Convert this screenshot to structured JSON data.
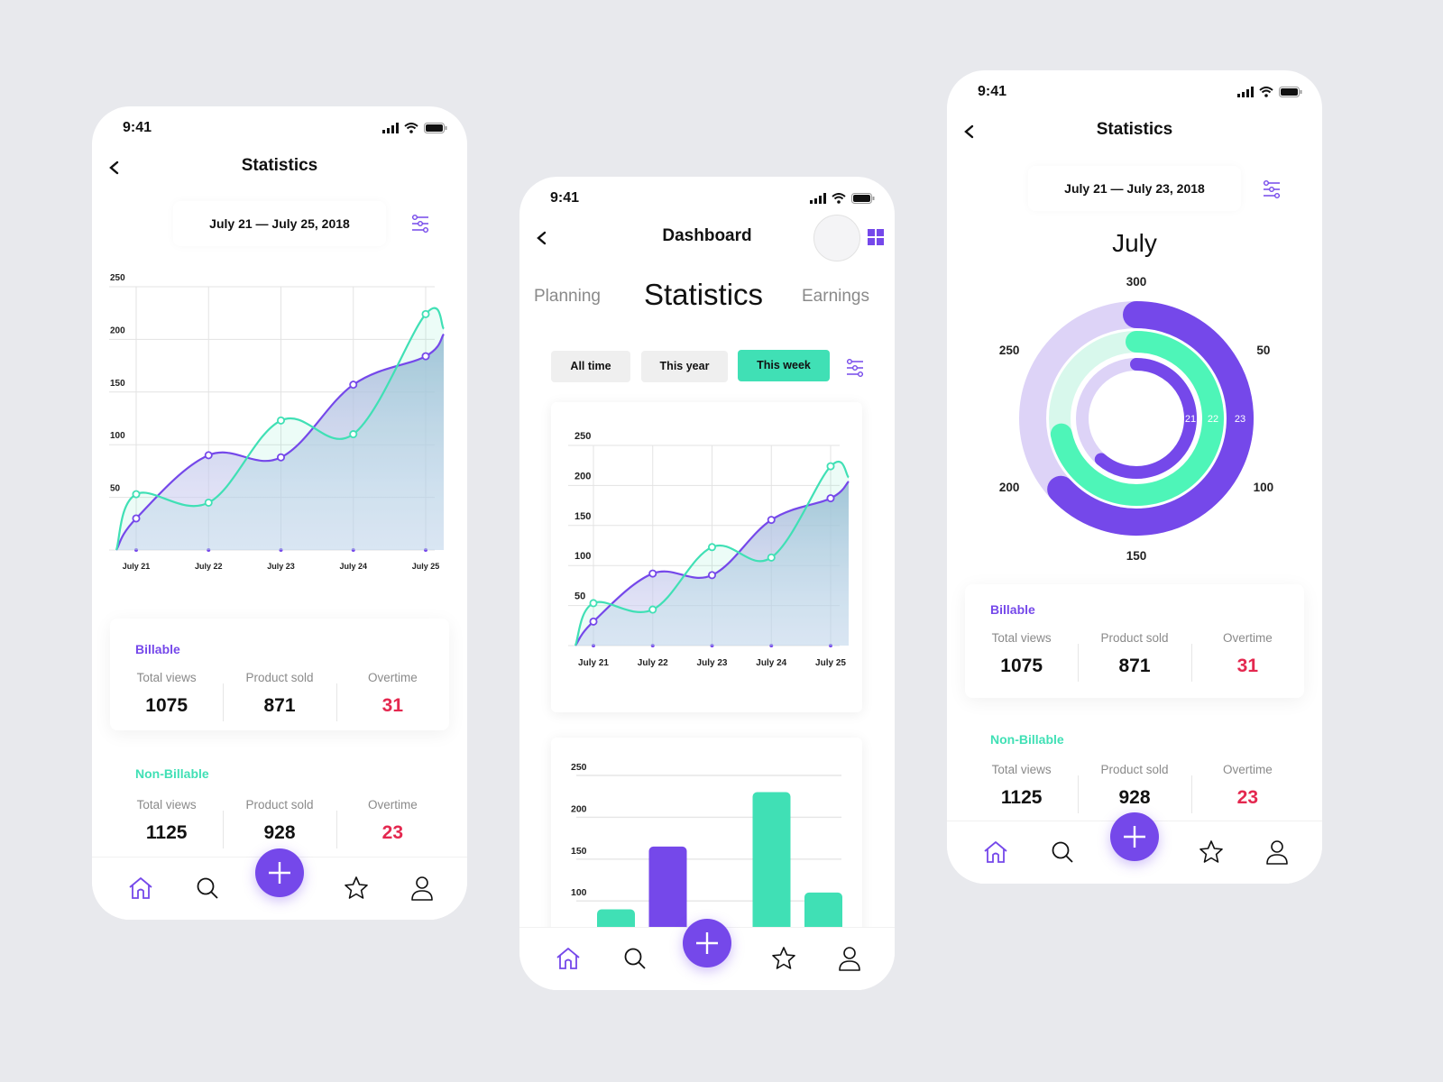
{
  "colors": {
    "background": "#e8e9ed",
    "purple": "#7548ea",
    "green": "#40e0b5",
    "green_bright": "#4ef5b8",
    "red": "#e4284f",
    "moon": "#f2c425"
  },
  "status_bar": {
    "time": "9:41"
  },
  "icons": {
    "back": "chevron-left-icon",
    "filter": "sliders-icon",
    "signal": "signal-icon",
    "wifi": "wifi-icon",
    "battery": "battery-icon",
    "moon": "moon-icon",
    "grid": "grid-icon",
    "home": "home-icon",
    "search": "search-icon",
    "add": "plus-icon",
    "star": "star-icon",
    "profile": "user-icon"
  },
  "screen_left": {
    "title": "Statistics",
    "date_range": "July 21 — July 25, 2018",
    "billable": {
      "label": "Billable",
      "metrics": [
        {
          "label": "Total views",
          "value": "1075",
          "highlight": false
        },
        {
          "label": "Product sold",
          "value": "871",
          "highlight": false
        },
        {
          "label": "Overtime",
          "value": "31",
          "highlight": true
        }
      ]
    },
    "non_billable": {
      "label": "Non-Billable",
      "metrics": [
        {
          "label": "Total views",
          "value": "1125",
          "highlight": false
        },
        {
          "label": "Product sold",
          "value": "928",
          "highlight": false
        },
        {
          "label": "Overtime",
          "value": "23",
          "highlight": true
        }
      ]
    }
  },
  "screen_middle": {
    "title": "Dashboard",
    "tabs": [
      {
        "label": "Planning",
        "active": false
      },
      {
        "label": "Statistics",
        "active": true
      },
      {
        "label": "Earnings",
        "active": false
      }
    ],
    "period_filters": [
      {
        "label": "All time",
        "active": false
      },
      {
        "label": "This year",
        "active": false
      },
      {
        "label": "This week",
        "active": true
      }
    ]
  },
  "screen_right": {
    "title": "Statistics",
    "date_range": "July 21 — July 23, 2018",
    "month": "July",
    "billable": {
      "label": "Billable",
      "metrics": [
        {
          "label": "Total views",
          "value": "1075",
          "highlight": false
        },
        {
          "label": "Product sold",
          "value": "871",
          "highlight": false
        },
        {
          "label": "Overtime",
          "value": "31",
          "highlight": true
        }
      ]
    },
    "non_billable": {
      "label": "Non-Billable",
      "metrics": [
        {
          "label": "Total views",
          "value": "1125",
          "highlight": false
        },
        {
          "label": "Product sold",
          "value": "928",
          "highlight": false
        },
        {
          "label": "Overtime",
          "value": "23",
          "highlight": true
        }
      ]
    }
  },
  "chart_data": [
    {
      "id": "line-left",
      "type": "area",
      "title": "",
      "categories": [
        "July 21",
        "July 22",
        "July 23",
        "July 24",
        "July 25"
      ],
      "yticks": [
        50,
        100,
        150,
        200,
        250
      ],
      "ylim": [
        0,
        250
      ],
      "grid": true,
      "series": [
        {
          "name": "Billable",
          "color": "#7548ea",
          "start": 0,
          "values": [
            30,
            90,
            88,
            157,
            184
          ],
          "end": 205
        },
        {
          "name": "Non-Billable",
          "color": "#40e0b5",
          "start": 0,
          "values": [
            53,
            45,
            123,
            110,
            224
          ],
          "end": 210
        }
      ]
    },
    {
      "id": "line-middle",
      "type": "area",
      "title": "",
      "categories": [
        "July 21",
        "July 22",
        "July 23",
        "July 24",
        "July 25"
      ],
      "yticks": [
        50,
        100,
        150,
        200,
        250
      ],
      "ylim": [
        0,
        250
      ],
      "grid": true,
      "series": [
        {
          "name": "Billable",
          "color": "#7548ea",
          "start": 0,
          "values": [
            30,
            90,
            88,
            157,
            184
          ],
          "end": 205
        },
        {
          "name": "Non-Billable",
          "color": "#40e0b5",
          "start": 0,
          "values": [
            53,
            45,
            123,
            110,
            224
          ],
          "end": 210
        }
      ]
    },
    {
      "id": "bar-middle",
      "type": "bar",
      "title": "",
      "yticks": [
        100,
        150,
        200,
        250
      ],
      "ylim": [
        0,
        250
      ],
      "grid": true,
      "bars": [
        {
          "value": 90,
          "color": "#40e0b5"
        },
        {
          "value": 165,
          "color": "#7548ea"
        },
        {
          "value": null,
          "color": "#40e0b5"
        },
        {
          "value": 230,
          "color": "#40e0b5"
        },
        {
          "value": 110,
          "color": "#40e0b5"
        }
      ]
    },
    {
      "id": "radial-right",
      "type": "pie",
      "title": "July",
      "scale": [
        0,
        300
      ],
      "tick_labels": [
        "300",
        "50",
        "100",
        "150",
        "200",
        "250"
      ],
      "rings": [
        {
          "label": "23",
          "value": 189,
          "color": "#7548ea",
          "track": "#ddd3f7"
        },
        {
          "label": "22",
          "value": 215,
          "color": "#4ef5b8",
          "track": "#d8f8ec"
        },
        {
          "label": "21",
          "value": 184,
          "color": "#7548ea",
          "track": "#ddd3f7"
        }
      ]
    }
  ]
}
